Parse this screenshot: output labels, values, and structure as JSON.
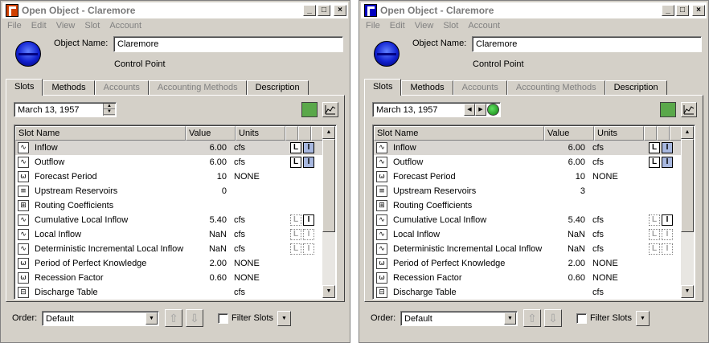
{
  "windows": [
    {
      "title": "Open Object - Claremore",
      "menu": [
        "File",
        "Edit",
        "View",
        "Slot",
        "Account"
      ],
      "object_name_label": "Object Name:",
      "object_name_value": "Claremore",
      "object_type": "Control Point",
      "tabs": [
        "Slots",
        "Methods",
        "Accounts",
        "Accounting Methods",
        "Description"
      ],
      "date": "March 13, 1957",
      "columns": [
        "Slot Name",
        "Value",
        "Units"
      ],
      "order_label": "Order:",
      "order_value": "Default",
      "filter_label": "Filter Slots",
      "slots": [
        {
          "name": "Inflow",
          "value": "6.00",
          "units": "cfs",
          "icon": "series-icon",
          "flags": [
            "L",
            "I"
          ]
        },
        {
          "name": "Outflow",
          "value": "6.00",
          "units": "cfs",
          "icon": "series-icon",
          "flags": [
            "L",
            "I"
          ]
        },
        {
          "name": "Forecast Period",
          "value": "10",
          "units": "NONE",
          "icon": "scalar-icon",
          "flags": []
        },
        {
          "name": "Upstream Reservoirs",
          "value": "0",
          "units": "",
          "icon": "list-icon",
          "flags": []
        },
        {
          "name": "Routing Coefficients",
          "value": "",
          "units": "",
          "icon": "table-icon",
          "flags": []
        },
        {
          "name": "Cumulative Local Inflow",
          "value": "5.40",
          "units": "cfs",
          "icon": "series-icon",
          "flags": [
            "L",
            "I"
          ]
        },
        {
          "name": "Local Inflow",
          "value": "NaN",
          "units": "cfs",
          "icon": "series-icon",
          "flags": [
            "L",
            "I"
          ]
        },
        {
          "name": "Deterministic Incremental Local Inflow",
          "value": "NaN",
          "units": "cfs",
          "icon": "series-icon",
          "flags": [
            "L",
            "I"
          ]
        },
        {
          "name": "Period of Perfect Knowledge",
          "value": "2.00",
          "units": "NONE",
          "icon": "scalar-icon",
          "flags": []
        },
        {
          "name": "Recession Factor",
          "value": "0.60",
          "units": "NONE",
          "icon": "scalar-icon",
          "flags": []
        },
        {
          "name": "Discharge Table",
          "value": "",
          "units": "cfs",
          "icon": "periodic-table-icon",
          "flags": []
        }
      ]
    },
    {
      "title": "Open Object - Claremore",
      "menu": [
        "File",
        "Edit",
        "View",
        "Slot",
        "Account"
      ],
      "object_name_label": "Object Name:",
      "object_name_value": "Claremore",
      "object_type": "Control Point",
      "tabs": [
        "Slots",
        "Methods",
        "Accounts",
        "Accounting Methods",
        "Description"
      ],
      "date": "March 13, 1957",
      "columns": [
        "Slot Name",
        "Value",
        "Units"
      ],
      "order_label": "Order:",
      "order_value": "Default",
      "filter_label": "Filter Slots",
      "slots": [
        {
          "name": "Inflow",
          "value": "6.00",
          "units": "cfs",
          "icon": "series-icon",
          "flags": [
            "L",
            "I"
          ]
        },
        {
          "name": "Outflow",
          "value": "6.00",
          "units": "cfs",
          "icon": "series-icon",
          "flags": [
            "L",
            "I"
          ]
        },
        {
          "name": "Forecast Period",
          "value": "10",
          "units": "NONE",
          "icon": "scalar-icon",
          "flags": []
        },
        {
          "name": "Upstream Reservoirs",
          "value": "3",
          "units": "",
          "icon": "list-icon",
          "flags": []
        },
        {
          "name": "Routing Coefficients",
          "value": "",
          "units": "",
          "icon": "table-icon",
          "flags": []
        },
        {
          "name": "Cumulative Local Inflow",
          "value": "5.40",
          "units": "cfs",
          "icon": "series-icon",
          "flags": [
            "L",
            "I"
          ]
        },
        {
          "name": "Local Inflow",
          "value": "NaN",
          "units": "cfs",
          "icon": "series-icon",
          "flags": [
            "L",
            "I"
          ]
        },
        {
          "name": "Deterministic Incremental Local Inflow",
          "value": "NaN",
          "units": "cfs",
          "icon": "series-icon",
          "flags": [
            "L",
            "I"
          ]
        },
        {
          "name": "Period of Perfect Knowledge",
          "value": "2.00",
          "units": "NONE",
          "icon": "scalar-icon",
          "flags": []
        },
        {
          "name": "Recession Factor",
          "value": "0.60",
          "units": "NONE",
          "icon": "scalar-icon",
          "flags": []
        },
        {
          "name": "Discharge Table",
          "value": "",
          "units": "cfs",
          "icon": "periodic-table-icon",
          "flags": []
        }
      ]
    }
  ],
  "colors": {
    "face": "#d4d0c8",
    "orb": "#1020d0",
    "green": "#5aa84a"
  }
}
